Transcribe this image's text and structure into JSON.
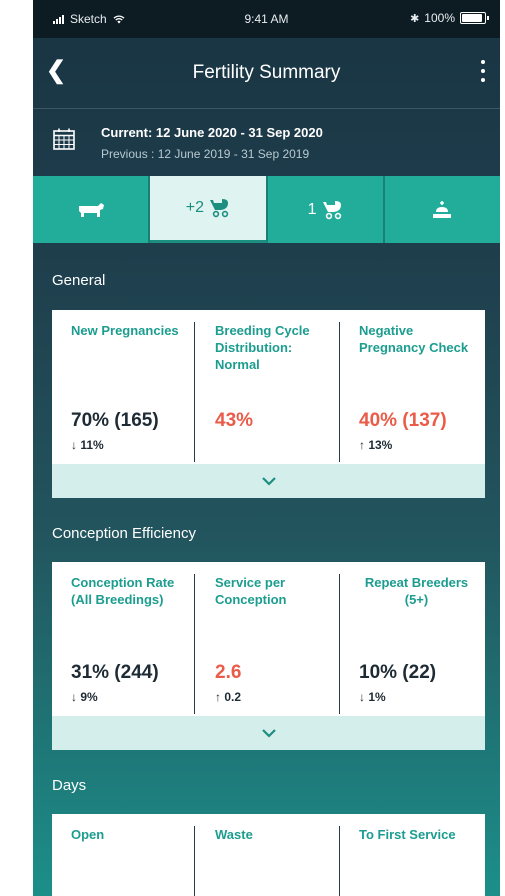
{
  "status_bar": {
    "carrier": "Sketch",
    "time": "9:41 AM",
    "battery": "100%",
    "battery_level": 1.0
  },
  "header": {
    "title": "Fertility Summary"
  },
  "date_range": {
    "current": "Current: 12 June 2020 - 31 Sep 2020",
    "previous": "Previous : 12 June 2019 - 31 Sep 2019"
  },
  "tabs": [
    {
      "icon": "cow-icon",
      "label": ""
    },
    {
      "icon": "stroller-icon",
      "label": "+2"
    },
    {
      "icon": "stroller-icon",
      "label": "1"
    },
    {
      "icon": "calf-icon",
      "label": ""
    }
  ],
  "sections": {
    "general": {
      "title": "General",
      "metrics": [
        {
          "label": "New Pregnancies",
          "value": "70% (165)",
          "delta": "↓ 11%"
        },
        {
          "label": "Breeding Cycle Distribution: Normal",
          "value": "43%",
          "delta": ""
        },
        {
          "label": "Negative Pregnancy Check",
          "value": "40% (137)",
          "delta": "↑ 13%"
        }
      ]
    },
    "conception": {
      "title": "Conception Efficiency",
      "metrics": [
        {
          "label": "Conception Rate (All Breedings)",
          "value": "31% (244)",
          "delta": "↓ 9%"
        },
        {
          "label": "Service per Conception",
          "value": "2.6",
          "delta": "↑ 0.2"
        },
        {
          "label": "Repeat Breeders (5+)",
          "value": "10% (22)",
          "delta": "↓ 1%"
        }
      ]
    },
    "days": {
      "title": "Days",
      "metrics": [
        {
          "label": "Open"
        },
        {
          "label": "Waste"
        },
        {
          "label": "To First Service"
        }
      ]
    }
  },
  "colors": {
    "accent": "#22ad9b",
    "negative": "#ea5b48",
    "header_bg": "#193443"
  }
}
